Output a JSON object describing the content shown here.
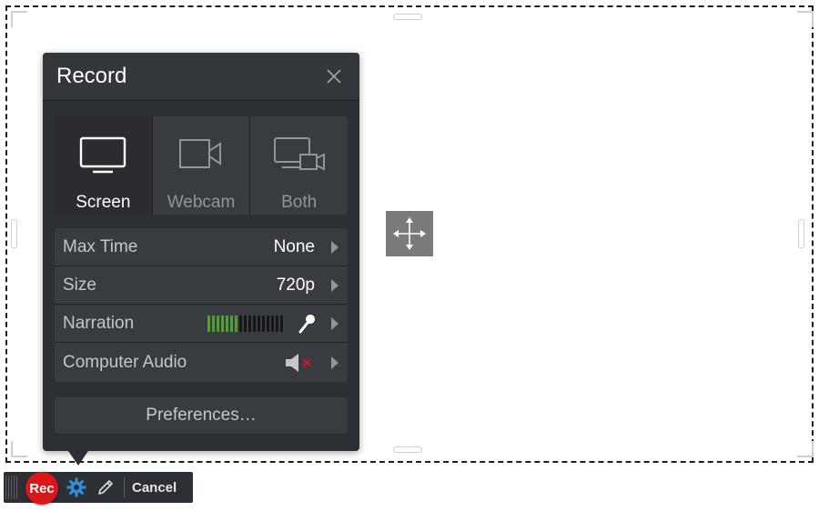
{
  "panel": {
    "title": "Record",
    "close_icon": "close-icon"
  },
  "sources": [
    {
      "label": "Screen",
      "icon": "monitor-icon",
      "selected": true
    },
    {
      "label": "Webcam",
      "icon": "webcam-icon",
      "selected": false
    },
    {
      "label": "Both",
      "icon": "screen-and-webcam-icon",
      "selected": false
    }
  ],
  "settings": {
    "max_time": {
      "label": "Max Time",
      "value": "None"
    },
    "size": {
      "label": "Size",
      "value": "720p"
    },
    "narration": {
      "label": "Narration",
      "icon": "microphone-icon",
      "level_bars_active": 7,
      "level_bars_total": 17
    },
    "computer_audio": {
      "label": "Computer Audio",
      "icon": "speaker-muted-icon"
    }
  },
  "preferences_label": "Preferences…",
  "toolbar": {
    "rec_label": "Rec",
    "settings_icon": "gear-icon",
    "draw_icon": "pencil-icon",
    "cancel_label": "Cancel"
  },
  "colors": {
    "panel_bg": "#2c2f33",
    "rec_red": "#d8161b",
    "level_green": "#50a02f",
    "gear_blue": "#2f8fd8",
    "mute_red": "#d8161b"
  }
}
